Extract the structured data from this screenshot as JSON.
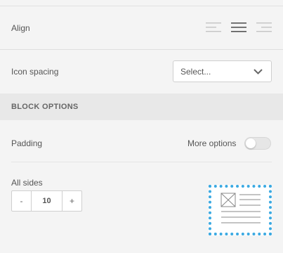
{
  "align": {
    "label": "Align",
    "options": [
      {
        "name": "align-left-icon"
      },
      {
        "name": "align-center-icon"
      },
      {
        "name": "align-right-icon"
      }
    ],
    "selected": "align-center-icon"
  },
  "icon_spacing": {
    "label": "Icon spacing",
    "select_value": "Select...",
    "chevron_icon": "chevron-down-icon"
  },
  "block_options": {
    "title": "BLOCK OPTIONS",
    "padding_label": "Padding",
    "more_options_label": "More options",
    "more_options_on": false,
    "all_sides_label": "All sides",
    "stepper": {
      "minus": "-",
      "value": "10",
      "plus": "+"
    },
    "preview_icon": "padding-preview-icon"
  },
  "colors": {
    "accent": "#3aa9e2",
    "section_bg": "#e8e8e8",
    "panel_bg": "#f4f4f4"
  }
}
